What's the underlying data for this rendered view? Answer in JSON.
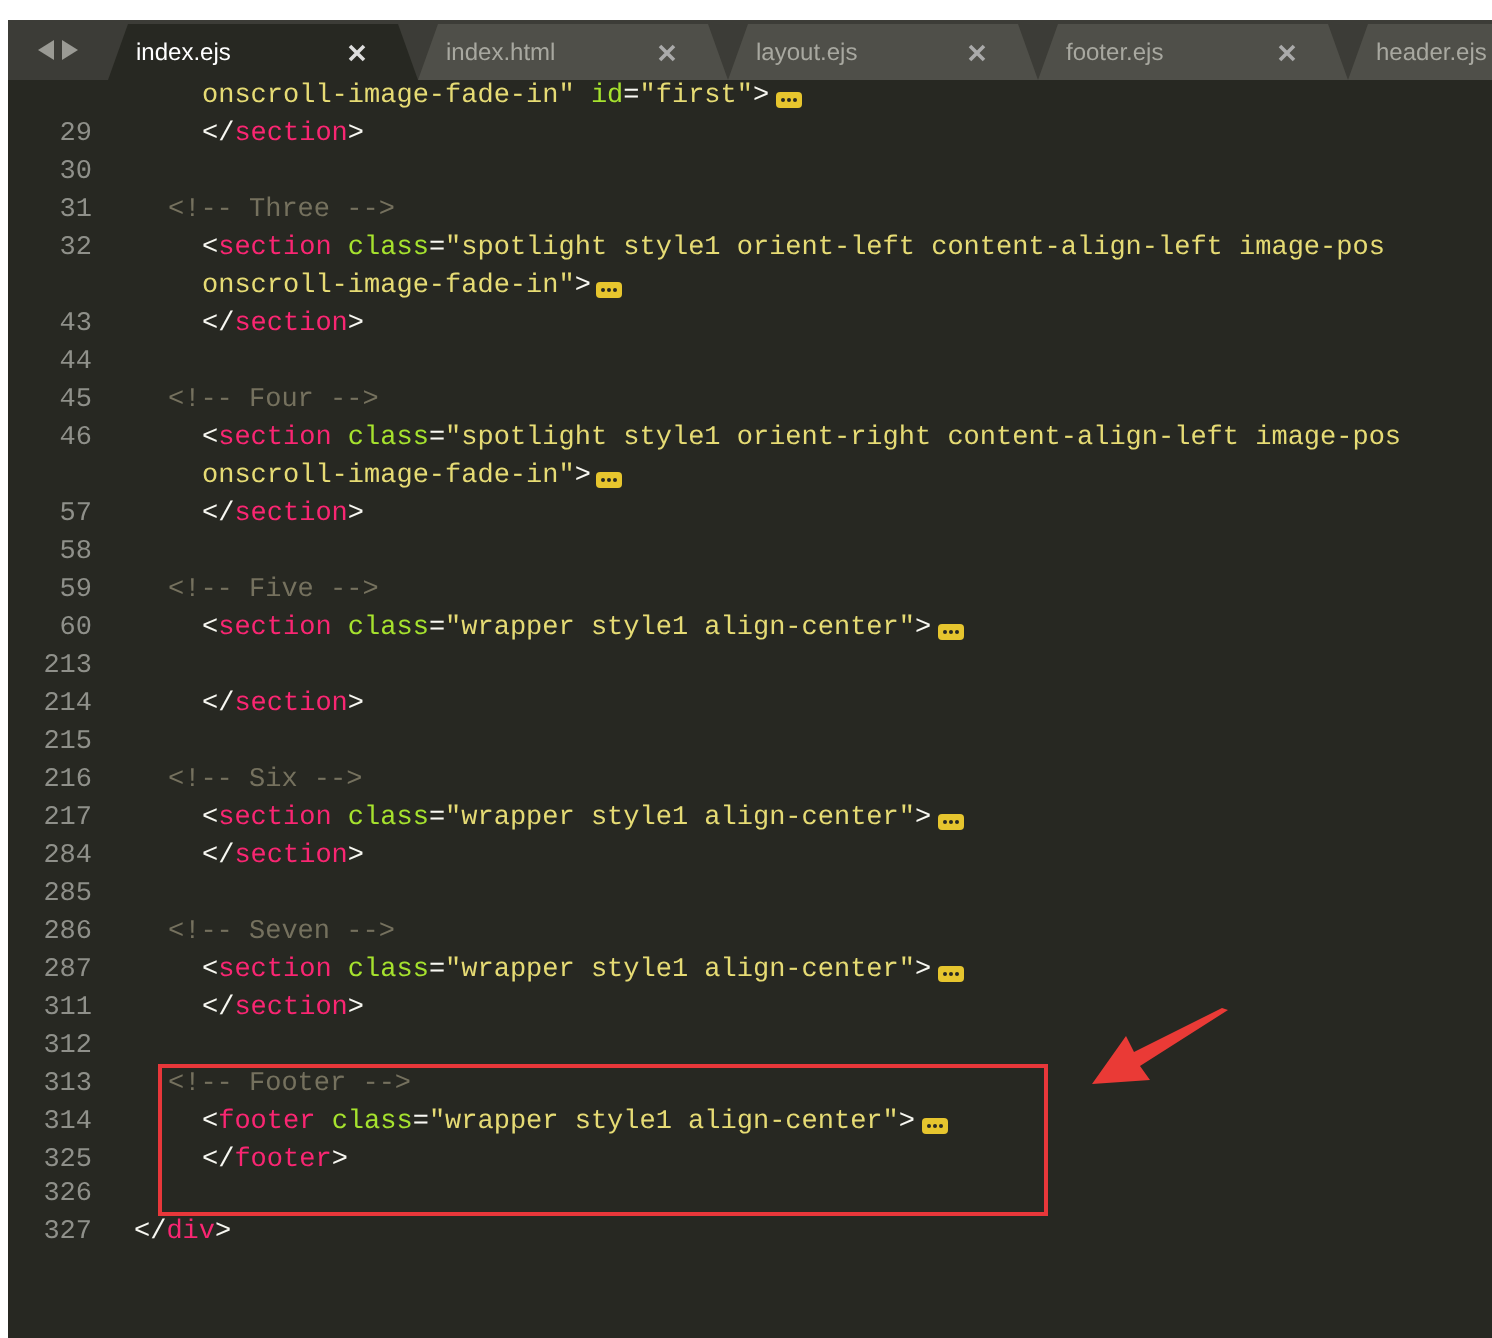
{
  "tabs": [
    {
      "label": "index.ejs",
      "selected": true,
      "closable": true
    },
    {
      "label": "index.html",
      "selected": false,
      "closable": true
    },
    {
      "label": "layout.ejs",
      "selected": false,
      "closable": true
    },
    {
      "label": "footer.ejs",
      "selected": false,
      "closable": true
    },
    {
      "label": "header.ejs",
      "selected": false,
      "closable": false
    }
  ],
  "editor": {
    "arrow": true,
    "lines": [
      {
        "kind": "continuation",
        "folded": true,
        "tokens": [
          {
            "string": "onscroll-image-fade-in\""
          },
          {
            "attr": " id"
          },
          {
            "punct": "="
          },
          {
            "string": "\"first\""
          },
          {
            "punct": ">"
          }
        ]
      },
      {
        "num": "29",
        "kind": "element",
        "tokens": [
          {
            "punct": "</"
          },
          {
            "tag": "section"
          },
          {
            "punct": ">"
          }
        ]
      },
      {
        "num": "30",
        "kind": "blank"
      },
      {
        "num": "31",
        "kind": "comment",
        "tokens": [
          {
            "comment": "<!-- Three -->"
          }
        ]
      },
      {
        "num": "32",
        "kind": "element",
        "tokens": [
          {
            "punct": "<"
          },
          {
            "tag": "section"
          },
          {
            "attr": " class"
          },
          {
            "punct": "="
          },
          {
            "string": "\"spotlight style1 orient-left content-align-left image-pos"
          }
        ]
      },
      {
        "kind": "continuation",
        "folded": true,
        "tokens": [
          {
            "string": "onscroll-image-fade-in\""
          },
          {
            "punct": ">"
          }
        ]
      },
      {
        "num": "43",
        "kind": "element",
        "tokens": [
          {
            "punct": "</"
          },
          {
            "tag": "section"
          },
          {
            "punct": ">"
          }
        ]
      },
      {
        "num": "44",
        "kind": "blank"
      },
      {
        "num": "45",
        "kind": "comment",
        "tokens": [
          {
            "comment": "<!-- Four -->"
          }
        ]
      },
      {
        "num": "46",
        "kind": "element",
        "tokens": [
          {
            "punct": "<"
          },
          {
            "tag": "section"
          },
          {
            "attr": " class"
          },
          {
            "punct": "="
          },
          {
            "string": "\"spotlight style1 orient-right content-align-left image-pos"
          }
        ]
      },
      {
        "kind": "continuation",
        "folded": true,
        "tokens": [
          {
            "string": "onscroll-image-fade-in\""
          },
          {
            "punct": ">"
          }
        ]
      },
      {
        "num": "57",
        "kind": "element",
        "tokens": [
          {
            "punct": "</"
          },
          {
            "tag": "section"
          },
          {
            "punct": ">"
          }
        ]
      },
      {
        "num": "58",
        "kind": "blank"
      },
      {
        "num": "59",
        "kind": "comment",
        "tokens": [
          {
            "comment": "<!-- Five -->"
          }
        ]
      },
      {
        "num": "60",
        "kind": "element",
        "folded": true,
        "tokens": [
          {
            "punct": "<"
          },
          {
            "tag": "section"
          },
          {
            "attr": " class"
          },
          {
            "punct": "="
          },
          {
            "string": "\"wrapper style1 align-center\""
          },
          {
            "punct": ">"
          }
        ]
      },
      {
        "num": "213",
        "kind": "blank"
      },
      {
        "num": "214",
        "kind": "element",
        "tokens": [
          {
            "punct": "</"
          },
          {
            "tag": "section"
          },
          {
            "punct": ">"
          }
        ]
      },
      {
        "num": "215",
        "kind": "blank"
      },
      {
        "num": "216",
        "kind": "comment",
        "tokens": [
          {
            "comment": "<!-- Six -->"
          }
        ]
      },
      {
        "num": "217",
        "kind": "element",
        "folded": true,
        "tokens": [
          {
            "punct": "<"
          },
          {
            "tag": "section"
          },
          {
            "attr": " class"
          },
          {
            "punct": "="
          },
          {
            "string": "\"wrapper style1 align-center\""
          },
          {
            "punct": ">"
          }
        ]
      },
      {
        "num": "284",
        "kind": "element",
        "tokens": [
          {
            "punct": "</"
          },
          {
            "tag": "section"
          },
          {
            "punct": ">"
          }
        ]
      },
      {
        "num": "285",
        "kind": "blank"
      },
      {
        "num": "286",
        "kind": "comment",
        "tokens": [
          {
            "comment": "<!-- Seven -->"
          }
        ]
      },
      {
        "num": "287",
        "kind": "element",
        "folded": true,
        "tokens": [
          {
            "punct": "<"
          },
          {
            "tag": "section"
          },
          {
            "attr": " class"
          },
          {
            "punct": "="
          },
          {
            "string": "\"wrapper style1 align-center\""
          },
          {
            "punct": ">"
          }
        ]
      },
      {
        "num": "311",
        "kind": "element",
        "tokens": [
          {
            "punct": "</"
          },
          {
            "tag": "section"
          },
          {
            "punct": ">"
          }
        ]
      },
      {
        "num": "312",
        "kind": "blank"
      },
      {
        "num": "313",
        "kind": "comment",
        "boxed": true,
        "tokens": [
          {
            "comment": "<!-- Footer -->"
          }
        ]
      },
      {
        "num": "314",
        "kind": "element",
        "boxed": true,
        "folded": true,
        "tokens": [
          {
            "punct": "<"
          },
          {
            "tag": "footer"
          },
          {
            "attr": " class"
          },
          {
            "punct": "="
          },
          {
            "string": "\"wrapper style1 align-center\""
          },
          {
            "punct": ">"
          }
        ]
      },
      {
        "num": "325",
        "kind": "element",
        "boxed": true,
        "tokens": [
          {
            "punct": "</"
          },
          {
            "tag": "footer"
          },
          {
            "punct": ">"
          }
        ]
      },
      {
        "num": "326",
        "kind": "blank",
        "boxed": true
      },
      {
        "num": "327",
        "kind": "root",
        "tokens": [
          {
            "punct": "</"
          },
          {
            "tag": "div"
          },
          {
            "punct": ">"
          }
        ]
      }
    ]
  }
}
